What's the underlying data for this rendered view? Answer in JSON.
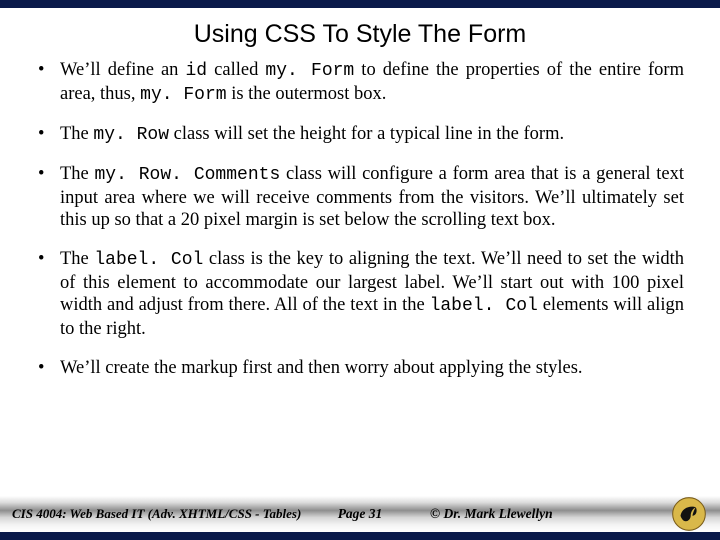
{
  "title": "Using CSS To Style The Form",
  "bullets": {
    "b0": {
      "t0": "We’ll define an ",
      "c1": "id",
      "t1": " called ",
      "c2": "my. Form",
      "t2": " to define the properties of the entire form area, thus, ",
      "c3": "my. Form",
      "t3": " is the outermost box."
    },
    "b1": {
      "t0": "The ",
      "c1": "my. Row",
      "t1": "  class will set the height for a typical line in the form."
    },
    "b2": {
      "t0": "The ",
      "c1": "my. Row. Comments",
      "t1": " class will configure a form area that is a general text input area where we will receive comments from the visitors.  We’ll ultimately set this up so that a 20 pixel margin is set below the scrolling text box."
    },
    "b3": {
      "t0": "The ",
      "c1": "label. Col",
      "t1": " class is the key to aligning the text.  We’ll need to set the width of this element to accommodate our largest label.  We’ll start out with 100 pixel width and adjust from there.  All of the text in the ",
      "c2": "label. Col",
      "t2": "  elements will align to the right."
    },
    "b4": {
      "t0": "We’ll create the markup first and then worry about applying the styles."
    }
  },
  "footer": {
    "left": "CIS 4004: Web Based IT (Adv. XHTML/CSS - Tables)",
    "page": "Page 31",
    "right": "© Dr. Mark Llewellyn"
  }
}
